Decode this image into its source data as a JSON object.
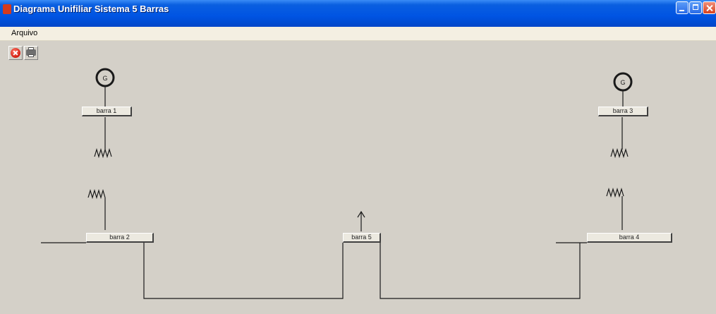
{
  "window": {
    "title": "Diagrama Unifiliar Sistema 5 Barras",
    "controls": [
      "minimize",
      "maximize",
      "close"
    ]
  },
  "menu": {
    "items": [
      "Arquivo"
    ]
  },
  "toolbar": {
    "buttons": [
      {
        "icon": "stop-icon"
      },
      {
        "icon": "printer-icon"
      }
    ]
  },
  "diagram": {
    "generators": [
      {
        "symbol": "G",
        "bus": "barra 1"
      },
      {
        "symbol": "G",
        "bus": "barra 3"
      }
    ],
    "buses": [
      {
        "label": "barra 1"
      },
      {
        "label": "barra 2"
      },
      {
        "label": "barra 3"
      },
      {
        "label": "barra 4"
      },
      {
        "label": "barra 5"
      }
    ],
    "load": {
      "bus": "barra 5"
    },
    "colors": {
      "line": "#1a1a1a",
      "background": "#d4d0c8",
      "titlebar": "#0054e3"
    }
  }
}
